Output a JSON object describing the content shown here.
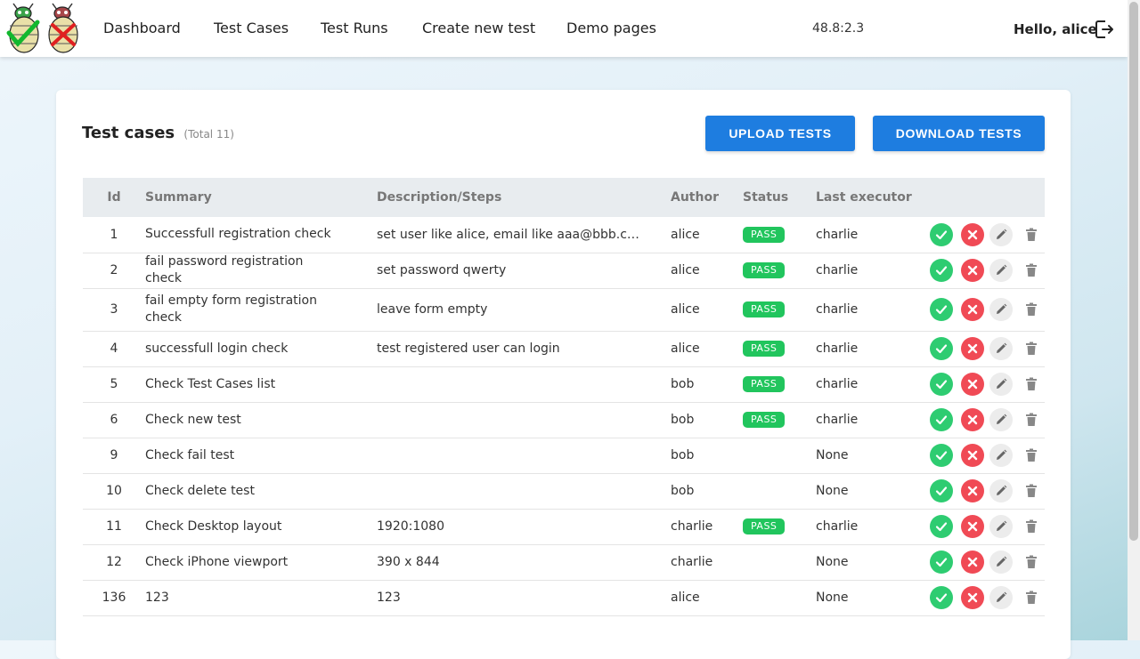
{
  "nav": {
    "items": [
      "Dashboard",
      "Test Cases",
      "Test Runs",
      "Create new test",
      "Demo pages"
    ],
    "version": "48.8:2.3",
    "greeting": "Hello, alice"
  },
  "card": {
    "title": "Test cases",
    "total": "(Total 11)",
    "upload_label": "UPLOAD TESTS",
    "download_label": "DOWNLOAD TESTS"
  },
  "table": {
    "headers": {
      "id": "Id",
      "summary": "Summary",
      "description": "Description/Steps",
      "author": "Author",
      "status": "Status",
      "executor": "Last executor"
    },
    "rows": [
      {
        "id": "1",
        "summary": "Successfull registration check",
        "description": "set user like alice, email like aaa@bbb.co...",
        "author": "alice",
        "status": "PASS",
        "executor": "charlie"
      },
      {
        "id": "2",
        "summary": "fail password registration check",
        "description": "set password qwerty",
        "author": "alice",
        "status": "PASS",
        "executor": "charlie"
      },
      {
        "id": "3",
        "summary": "fail empty form registration check",
        "description": "leave form empty",
        "author": "alice",
        "status": "PASS",
        "executor": "charlie"
      },
      {
        "id": "4",
        "summary": "successfull login check",
        "description": "test registered user can login",
        "author": "alice",
        "status": "PASS",
        "executor": "charlie"
      },
      {
        "id": "5",
        "summary": "Check Test Cases list",
        "description": "",
        "author": "bob",
        "status": "PASS",
        "executor": "charlie"
      },
      {
        "id": "6",
        "summary": "Check new test",
        "description": "",
        "author": "bob",
        "status": "PASS",
        "executor": "charlie"
      },
      {
        "id": "9",
        "summary": "Check fail test",
        "description": "",
        "author": "bob",
        "status": "",
        "executor": "None"
      },
      {
        "id": "10",
        "summary": "Check delete test",
        "description": "",
        "author": "bob",
        "status": "",
        "executor": "None"
      },
      {
        "id": "11",
        "summary": "Check Desktop layout",
        "description": "1920:1080",
        "author": "charlie",
        "status": "PASS",
        "executor": "charlie"
      },
      {
        "id": "12",
        "summary": "Check iPhone viewport",
        "description": "390 x 844",
        "author": "charlie",
        "status": "",
        "executor": "None"
      },
      {
        "id": "136",
        "summary": "123",
        "description": "123",
        "author": "alice",
        "status": "",
        "executor": "None"
      }
    ]
  },
  "colors": {
    "primary": "#1e7de0",
    "pass": "#21c55d",
    "fail": "#f04a55"
  },
  "icons": [
    "bug-pass-logo",
    "bug-fail-logo",
    "logout-icon",
    "check-icon",
    "close-icon",
    "pencil-icon",
    "trash-icon"
  ]
}
